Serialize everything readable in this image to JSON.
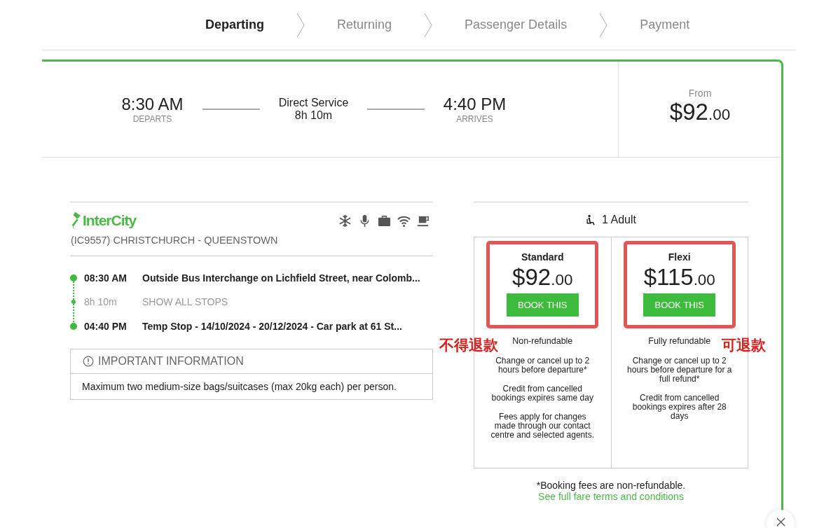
{
  "steps": [
    {
      "label": "Departing",
      "selected": true
    },
    {
      "label": "Returning",
      "selected": false
    },
    {
      "label": "Passenger Details",
      "selected": false
    },
    {
      "label": "Payment",
      "selected": false
    }
  ],
  "trip": {
    "depart_time": "8:30 AM",
    "depart_label": "DEPARTS",
    "service": "Direct Service",
    "duration": "8h 10m",
    "arrive_time": "4:40 PM",
    "arrive_label": "ARRIVES"
  },
  "from": {
    "label": "From",
    "price": "$92",
    "cents": ".00"
  },
  "operator": {
    "logo_text": "InterCity",
    "route": "(IC9557) CHRISTCHURCH - QUEENSTOWN"
  },
  "stops": [
    {
      "kind": "stop",
      "time": "08:30 AM",
      "place": "Outside Bus Interchange on Lichfield Street, near Colomb..."
    },
    {
      "kind": "duration",
      "time": "8h 10m",
      "place": "SHOW ALL STOPS"
    },
    {
      "kind": "stop",
      "time": "04:40 PM",
      "place": "Temp Stop - 14/10/2024 - 20/12/2024 - Car park at 61 St..."
    }
  ],
  "info": {
    "title": "IMPORTANT INFORMATION",
    "text": "Maximum two medium-size bags/suitcases (max 20kg each) per person."
  },
  "fares": {
    "passengers": "1 Adult",
    "options": [
      {
        "name": "Standard",
        "price": "$92",
        "cents": ".00",
        "button": "BOOK THIS",
        "highlighted": true,
        "refund": "Non-refundable",
        "annotation": "不得退款",
        "notes": [
          "Change or cancel up to 2 hours before departure*",
          "Credit from cancelled bookings expires same day",
          "Fees apply for changes made through our contact centre and selected agents."
        ]
      },
      {
        "name": "Flexi",
        "price": "$115",
        "cents": ".00",
        "button": "BOOK THIS",
        "highlighted": true,
        "refund": "Fully refundable",
        "annotation": "可退款",
        "notes": [
          "Change or cancel up to 2 hours before departure for a full refund*",
          "Credit from cancelled bookings expires after 28 days"
        ]
      }
    ]
  },
  "footnote": "*Booking fees are non-refundable.",
  "terms_link": "See full fare terms and conditions"
}
